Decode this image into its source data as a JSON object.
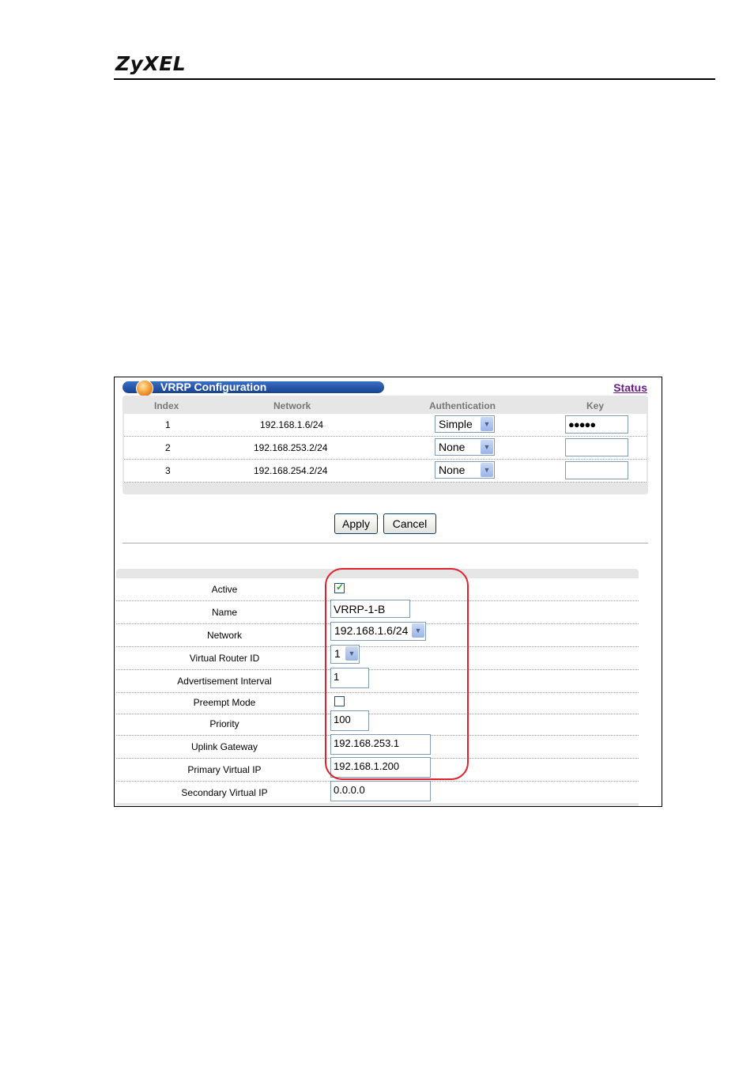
{
  "doc": {
    "logo": "ZyXEL"
  },
  "window": {
    "title": "VRRP Configuration",
    "status_link": "Status"
  },
  "table": {
    "headers": {
      "index": "Index",
      "network": "Network",
      "authentication": "Authentication",
      "key": "Key"
    },
    "rows": [
      {
        "index": "1",
        "network": "192.168.1.6/24",
        "auth": "Simple",
        "key_masked": "●●●●●"
      },
      {
        "index": "2",
        "network": "192.168.253.2/24",
        "auth": "None",
        "key_masked": ""
      },
      {
        "index": "3",
        "network": "192.168.254.2/24",
        "auth": "None",
        "key_masked": ""
      }
    ]
  },
  "buttons": {
    "apply": "Apply",
    "cancel": "Cancel"
  },
  "form": {
    "active": {
      "label": "Active",
      "checked": true
    },
    "name": {
      "label": "Name",
      "value": "VRRP-1-B"
    },
    "network": {
      "label": "Network",
      "value": "192.168.1.6/24"
    },
    "virtual_router_id": {
      "label": "Virtual Router ID",
      "value": "1"
    },
    "advertisement_interval": {
      "label": "Advertisement Interval",
      "value": "1"
    },
    "preempt_mode": {
      "label": "Preempt Mode",
      "checked": false
    },
    "priority": {
      "label": "Priority",
      "value": "100"
    },
    "uplink_gateway": {
      "label": "Uplink Gateway",
      "value": "192.168.253.1"
    },
    "primary_virtual_ip": {
      "label": "Primary Virtual IP",
      "value": "192.168.1.200"
    },
    "secondary_virtual_ip": {
      "label": "Secondary Virtual IP",
      "value": "0.0.0.0"
    }
  },
  "colors": {
    "title_bar": "#1f4fa8",
    "status_link": "#6a1b8a",
    "highlight": "#e0202a"
  },
  "icons": {
    "title_orb": "orange-orb-icon",
    "dropdown": "chevron-down-icon",
    "check": "check-icon"
  }
}
